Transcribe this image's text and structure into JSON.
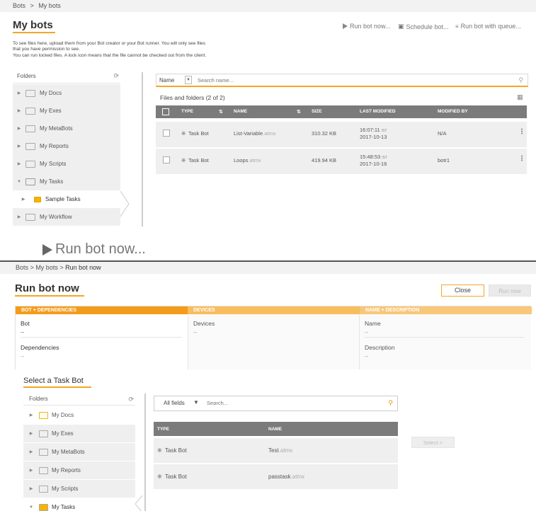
{
  "top": {
    "breadcrumb": [
      "Bots",
      ">",
      "My bots"
    ],
    "title": "My bots",
    "toolbar": {
      "run_now": "Run bot now...",
      "schedule": "Schedule bot...",
      "run_queue": "Run bot with queue..."
    },
    "description": [
      "To see files here, upload them from your Bot creator or your Bot runner. You will only see files",
      "that you have permission to see.",
      "You can run locked files. A lock icon means that the file cannot be checked out from the client."
    ],
    "folders_title": "Folders",
    "folders": [
      {
        "label": "My Docs"
      },
      {
        "label": "My Exes"
      },
      {
        "label": "My MetaBots"
      },
      {
        "label": "My Reports"
      },
      {
        "label": "My Scripts"
      },
      {
        "label": "My Tasks"
      },
      {
        "label": "Sample Tasks"
      },
      {
        "label": "My Workflow"
      }
    ],
    "search": {
      "field": "Name",
      "placeholder": "Search name..."
    },
    "files_count": "Files and folders (2 of 2)",
    "columns": {
      "type": "TYPE",
      "name": "NAME",
      "size": "SIZE",
      "modified": "LAST MODIFIED",
      "modified_by": "MODIFIED BY"
    },
    "rows": [
      {
        "type": "Task Bot",
        "name": "List-Variable",
        "ext": ".atmx",
        "size": "310.32 KB",
        "time": "16:07:11",
        "tz": "IST",
        "date": "2017-10-13",
        "by": "N/A"
      },
      {
        "type": "Task Bot",
        "name": "Loops",
        "ext": ".atmx",
        "size": "419.94 KB",
        "time": "15:48:53",
        "tz": "IST",
        "date": "2017-10-16",
        "by": "botr1"
      }
    ]
  },
  "heading": "Run bot now...",
  "bottom": {
    "breadcrumb": [
      "Bots",
      ">",
      "My bots",
      ">",
      "Run bot now"
    ],
    "title": "Run bot now",
    "close_label": "Close",
    "run_label": "Run now",
    "steps": [
      {
        "header": "BOT + DEPENDENCIES",
        "color": "#f59b1a"
      },
      {
        "header": "DEVICES",
        "color": "#f8bd5c"
      },
      {
        "header": "NAME + DESCRIPTION",
        "color": "#f8c778"
      }
    ],
    "bot_label": "Bot",
    "bot_value": "--",
    "deps_label": "Dependencies",
    "deps_value": "--",
    "devices_label": "Devices",
    "devices_value": "--",
    "name_label": "Name",
    "name_value": "--",
    "desc_label": "Description",
    "desc_value": "--",
    "select_title": "Select a Task Bot",
    "folders_title": "Folders",
    "folders": [
      {
        "label": "My Docs"
      },
      {
        "label": "My Exes"
      },
      {
        "label": "My MetaBots"
      },
      {
        "label": "My Reports"
      },
      {
        "label": "My Scripts"
      },
      {
        "label": "My Tasks"
      }
    ],
    "filter": {
      "field": "All fields",
      "placeholder": "Search..."
    },
    "columns": {
      "type": "TYPE",
      "name": "NAME"
    },
    "rows": [
      {
        "type": "Task Bot",
        "name": "Test",
        "ext": ".atmx"
      },
      {
        "type": "Task Bot",
        "name": "passtask",
        "ext": ".atmx"
      }
    ],
    "select_label": "Select >"
  },
  "colors": {
    "accent": "#f5a623",
    "header_gray": "#7b7b7b",
    "row_bg": "#efefef"
  }
}
